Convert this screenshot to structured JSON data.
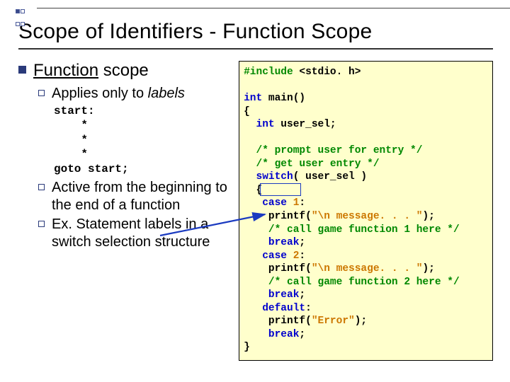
{
  "title": "Scope of Identifiers - Function Scope",
  "heading": {
    "prefix": "Function",
    "suffix": " scope"
  },
  "bullets": {
    "b1": {
      "prefix": "Applies only to ",
      "em": "labels"
    },
    "mono": "start:\n    *\n    *\n    *\ngoto start;",
    "b2": "Active from the beginning to the end of a function",
    "b3": "Ex. Statement labels in a switch selection structure"
  },
  "code": {
    "l01a": "#include",
    "l01b": " <stdio. h>",
    "l02": "",
    "l03a": "int",
    "l03b": " main()",
    "l04": "{",
    "l05a": "  int",
    "l05b": " user_sel;",
    "l06": "",
    "l07": "  /* prompt user for entry */",
    "l08": "  /* get user entry */",
    "l09a": "  switch",
    "l09b": "( user_sel )",
    "l10": "  {",
    "l11a": "   case",
    "l11b": " ",
    "l11c": "1",
    "l11d": ":",
    "l12a": "    printf(",
    "l12b": "\"\\n message. . . \"",
    "l12c": ");",
    "l13": "    /* call game function 1 here */",
    "l14a": "    break",
    "l14b": ";",
    "l15a": "   case",
    "l15b": " ",
    "l15c": "2",
    "l15d": ":",
    "l16a": "    printf(",
    "l16b": "\"\\n message. . . \"",
    "l16c": ");",
    "l17": "    /* call game function 2 here */",
    "l18a": "    break",
    "l18b": ";",
    "l19a": "   default",
    "l19b": ":",
    "l20a": "    printf(",
    "l20b": "\"Error\"",
    "l20c": ");",
    "l21a": "    break",
    "l21b": ";",
    "l22": "}"
  }
}
